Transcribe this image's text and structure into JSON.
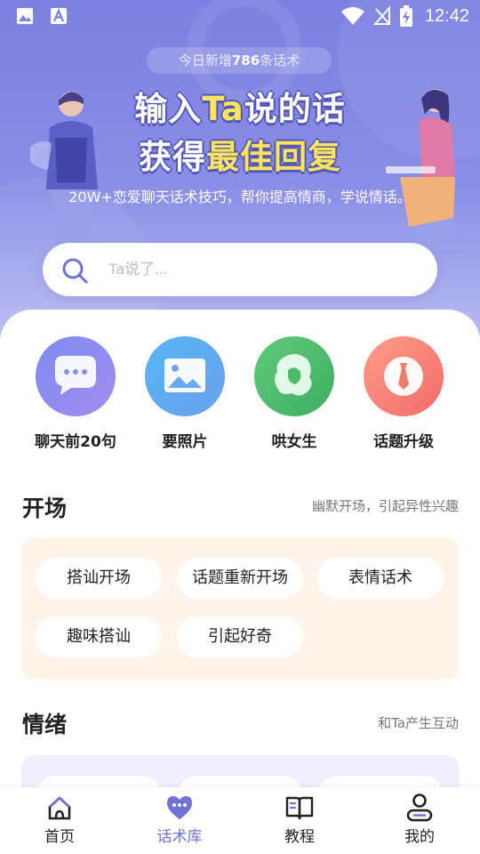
{
  "status_bar": {
    "time": "12:42"
  },
  "hero": {
    "badge_prefix": "今日新增",
    "badge_count": "786",
    "badge_suffix": "条话术",
    "title_line1_a": "输入",
    "title_line1_b": "Ta",
    "title_line1_c": "说的话",
    "title_line2_a": "获得",
    "title_line2_b": "最佳回复",
    "subtitle": "20W+恋爱聊天话术技巧，帮你提高情商，学说情话。"
  },
  "search": {
    "placeholder": "Ta说了..."
  },
  "quick_actions": [
    {
      "label": "聊天前20句",
      "icon": "chat-bubble-icon",
      "color_from": "#7b8cf0",
      "color_to": "#a58cf0"
    },
    {
      "label": "要照片",
      "icon": "picture-icon",
      "color_from": "#56b6f2",
      "color_to": "#6aa0f0"
    },
    {
      "label": "哄女生",
      "icon": "girl-head-icon",
      "color_from": "#5fca7a",
      "color_to": "#3fae63"
    },
    {
      "label": "话题升级",
      "icon": "tie-icon",
      "color_from": "#ff9d8a",
      "color_to": "#f26a6a"
    }
  ],
  "sections": [
    {
      "title": "开场",
      "subtitle": "幽默开场，引起异性兴趣",
      "bg": "#fff3ea",
      "chips": [
        "搭讪开场",
        "话题重新开场",
        "表情话术",
        "趣味搭讪",
        "引起好奇"
      ]
    },
    {
      "title": "情绪",
      "subtitle": "和Ta产生互动",
      "bg": "#f1efff",
      "chips": []
    }
  ],
  "nav": {
    "items": [
      {
        "label": "首页",
        "icon": "home-icon"
      },
      {
        "label": "话术库",
        "icon": "heart-chat-icon"
      },
      {
        "label": "教程",
        "icon": "book-icon"
      },
      {
        "label": "我的",
        "icon": "user-icon"
      }
    ],
    "active_index": 1,
    "active_color": "#6f73d9"
  }
}
